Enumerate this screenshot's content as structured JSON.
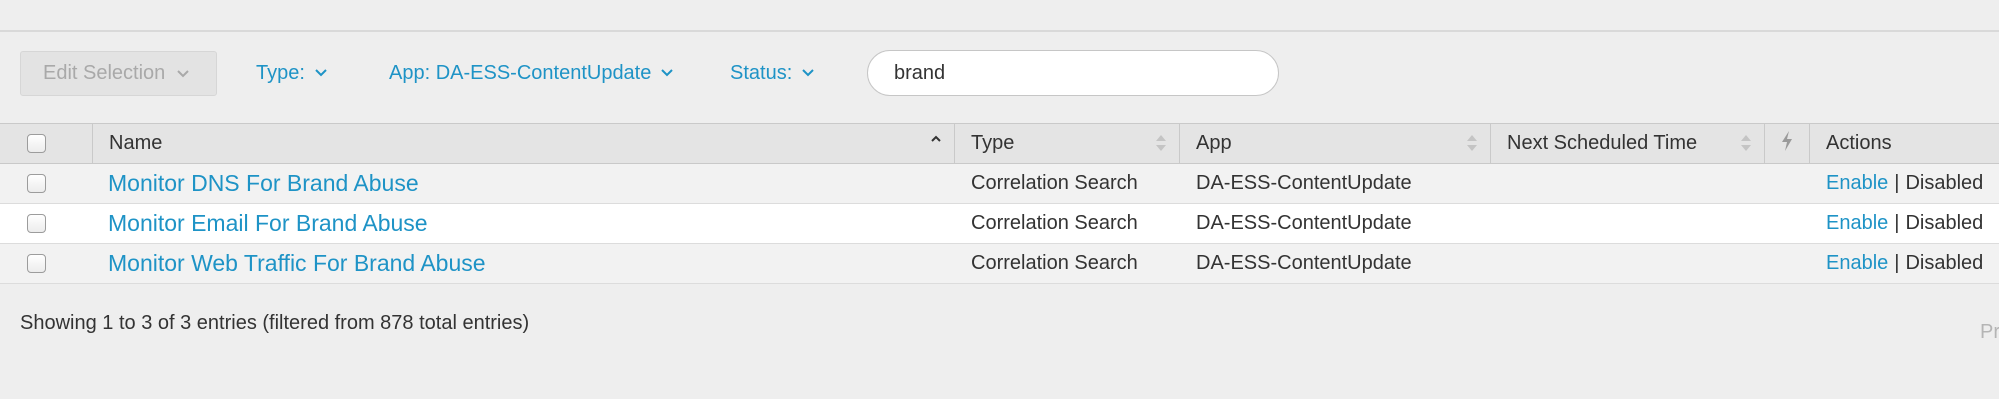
{
  "toolbar": {
    "edit_selection": "Edit Selection",
    "type_filter": "Type:",
    "app_filter": "App: DA-ESS-ContentUpdate",
    "status_filter": "Status:",
    "search_value": "brand"
  },
  "table": {
    "headers": {
      "name": "Name",
      "type": "Type",
      "app": "App",
      "next_scheduled": "Next Scheduled Time",
      "actions": "Actions"
    },
    "rows": [
      {
        "name": "Monitor DNS For Brand Abuse",
        "type": "Correlation Search",
        "app": "DA-ESS-ContentUpdate",
        "next": "",
        "enable": "Enable",
        "sep": "|",
        "status": "Disabled"
      },
      {
        "name": "Monitor Email For Brand Abuse",
        "type": "Correlation Search",
        "app": "DA-ESS-ContentUpdate",
        "next": "",
        "enable": "Enable",
        "sep": "|",
        "status": "Disabled"
      },
      {
        "name": "Monitor Web Traffic For Brand Abuse",
        "type": "Correlation Search",
        "app": "DA-ESS-ContentUpdate",
        "next": "",
        "enable": "Enable",
        "sep": "|",
        "status": "Disabled"
      }
    ]
  },
  "footer": {
    "info": "Showing 1 to 3 of 3 entries (filtered from 878 total entries)",
    "pager_prev": "Pr"
  },
  "colors": {
    "link": "#1e93c6",
    "background": "#eeeeee",
    "header_bg": "#e4e4e4"
  }
}
